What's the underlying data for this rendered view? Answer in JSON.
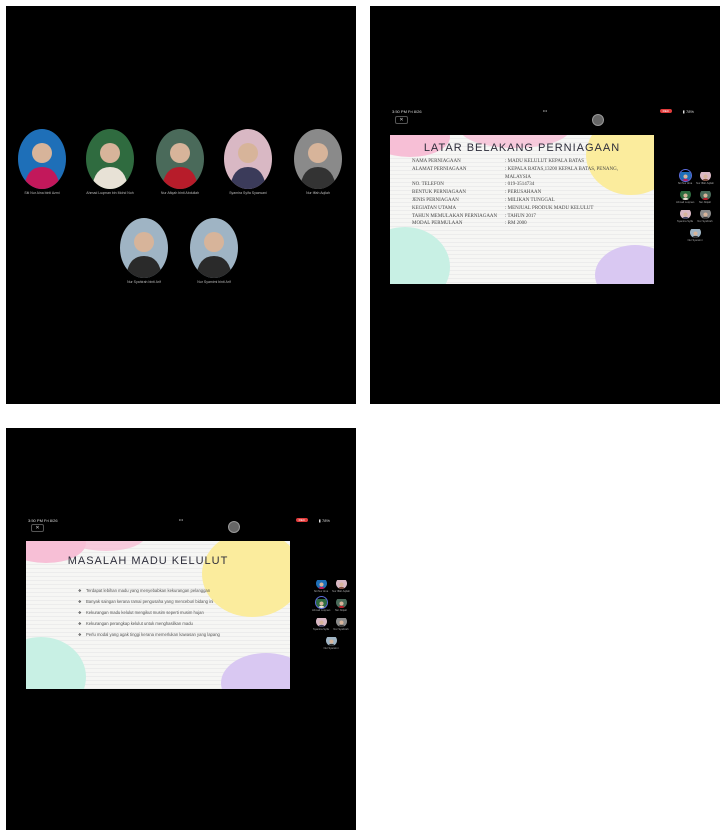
{
  "panel1": {
    "participants_row1": [
      {
        "name": "Siti Nur Aina binti Azmi",
        "avatar": "person-hijab-icon",
        "bg": "#1e6fb8",
        "fg": "#c2185b"
      },
      {
        "name": "Ahmad Luqman bin Mohd Noh",
        "avatar": "person-outdoor-icon",
        "bg": "#2f6b3f",
        "fg": "#e8e2d6"
      },
      {
        "name": "Nur Afiqah binti Abdullah",
        "avatar": "person-park-icon",
        "bg": "#4a6a5a",
        "fg": "#b71c2a"
      },
      {
        "name": "Syamira Syifa Syazwani",
        "avatar": "person-selfie-icon",
        "bg": "#d9b8c4",
        "fg": "#3b3b5a"
      },
      {
        "name": "Nur Iffah Aqilah",
        "avatar": "person-mono-icon",
        "bg": "#8a8a8a",
        "fg": "#333333"
      }
    ],
    "participants_row2": [
      {
        "name": "Nur Syahirah binti Arif",
        "avatar": "person-selfie-icon",
        "bg": "#9fb4c4",
        "fg": "#2a2a2a"
      },
      {
        "name": "Nur Syamimi binti Arif",
        "avatar": "person-selfie-icon",
        "bg": "#9fb4c4",
        "fg": "#2a2a2a"
      }
    ]
  },
  "panel2": {
    "status_time": "3:50 PM  Fri 8/26",
    "status_dots": "•••",
    "status_rec": "REC",
    "status_battery": "▮ 78%",
    "close_label": "✕",
    "slide_title": "LATAR BELAKANG PERNIAGAAN",
    "rows": [
      {
        "k": "NAMA PERNIAGAAN",
        "v": ": MADU KELULUT KEPALA BATAS"
      },
      {
        "k": "ALAMAT PERNIAGAAN",
        "v": ": KEPALA BATAS,13200 KEPALA BATAS, PENANG,"
      },
      {
        "k": "",
        "v": "  MALAYSIA"
      },
      {
        "k": "NO. TELEFON",
        "v": ": 019-3514734"
      },
      {
        "k": "BENTUK PERNIAGAAN",
        "v": ": PERUSAHAAN"
      },
      {
        "k": "JENIS PERNIAGAAN",
        "v": ": MILIKAN TUNGGAL"
      },
      {
        "k": "KEGIATAN  UTAMA",
        "v": ": MENJUAL PRODUK MADU KELULUT"
      },
      {
        "k": "TAHUN  MEMULAKAN PERNIAGAAN",
        "v": ": TAHUN 2017"
      },
      {
        "k": "MODAL PERMULAAN",
        "v": ": RM 2000"
      }
    ],
    "thumbs": [
      {
        "name": "Siti Nur Aina",
        "bg": "#1e6fb8",
        "fg": "#c2185b",
        "active": true
      },
      {
        "name": "Nur Iffah Aqilah",
        "bg": "#d9b8c4",
        "fg": "#7a4a3a",
        "active": false
      },
      {
        "name": "Ahmad Luqman",
        "bg": "#2f6b3f",
        "fg": "#e8e2d6",
        "active": false
      },
      {
        "name": "Nur Afiqah",
        "bg": "#4a6a5a",
        "fg": "#b71c2a",
        "active": false
      },
      {
        "name": "Syamira Syifa",
        "bg": "#d9b8c4",
        "fg": "#3b3b5a",
        "active": false
      },
      {
        "name": "Nur Syahirah",
        "bg": "#8a8a8a",
        "fg": "#333",
        "active": false
      },
      {
        "name": "Nur Syamimi",
        "bg": "#9fb4c4",
        "fg": "#2a2a2a",
        "active": false
      }
    ]
  },
  "panel3": {
    "status_time": "3:50 PM  Fri 8/26",
    "status_dots": "•••",
    "status_rec": "REC",
    "status_battery": "▮ 78%",
    "close_label": "✕",
    "slide_title": "MASALAH MADU KELULUT",
    "bullets": [
      "Terdapat lebihan madu yang menyebabkan kekurangan pelanggan",
      "Banyak saingan kerana ramai pengusaha yang menceburi bidang ini",
      "Kekurangan madu kelulut mengikut musim seperti musim hujan",
      "Kekurangan perangkap kelulut untuk menghasilkan madu",
      "Perlu modal yang agak tinggi kerana memerlukan kawasan yang lapang"
    ],
    "bullet_glyph": "❖",
    "thumbs": [
      {
        "name": "Siti Nur Aina",
        "bg": "#1e6fb8",
        "fg": "#c2185b",
        "active": false
      },
      {
        "name": "Nur Iffah Aqilah",
        "bg": "#d9b8c4",
        "fg": "#7a4a3a",
        "active": false
      },
      {
        "name": "Ahmad Luqman",
        "bg": "#2f6b3f",
        "fg": "#e8e2d6",
        "active": true
      },
      {
        "name": "Nur Afiqah",
        "bg": "#4a6a5a",
        "fg": "#b71c2a",
        "active": false
      },
      {
        "name": "Syamira Syifa",
        "bg": "#d9b8c4",
        "fg": "#3b3b5a",
        "active": false
      },
      {
        "name": "Nur Syahirah",
        "bg": "#8a8a8a",
        "fg": "#333",
        "active": false
      },
      {
        "name": "Nur Syamimi",
        "bg": "#9fb4c4",
        "fg": "#2a2a2a",
        "active": false
      }
    ]
  },
  "colors": {
    "pink_blob": "#f7bfd6",
    "yellow_blob": "#fbec9d",
    "mint_blob": "#c8f0e4",
    "lavender_blob": "#d9c8f2",
    "rec_red": "#e23c3c"
  }
}
